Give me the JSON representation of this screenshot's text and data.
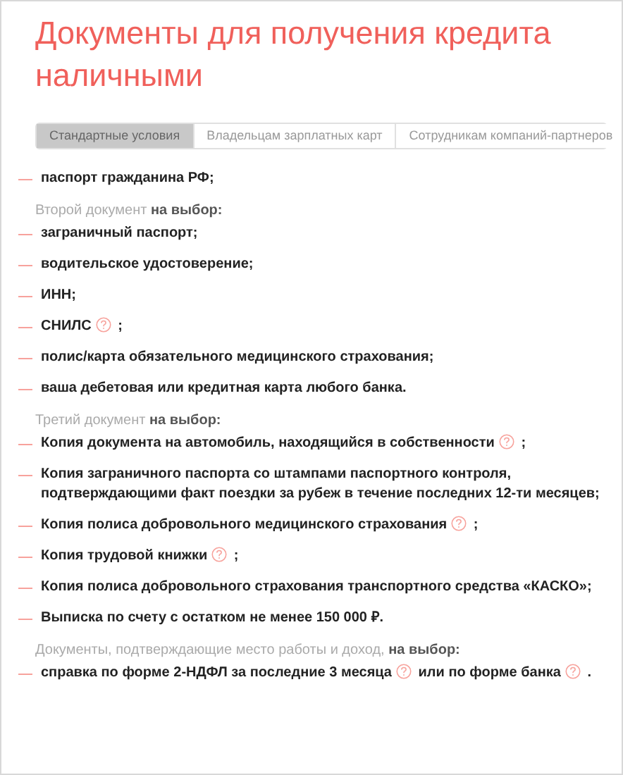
{
  "title": "Документы для получения кредита наличными",
  "tabs": [
    {
      "label": "Стандартные условия",
      "selected": true
    },
    {
      "label": "Владельцам зарплатных карт",
      "selected": false
    },
    {
      "label": "Сотрудникам компаний-партнеров",
      "selected": false
    }
  ],
  "sections": [
    {
      "items": [
        {
          "parts": [
            "паспорт гражданина РФ;"
          ]
        }
      ]
    },
    {
      "heading": "Второй документ **на выбор:**",
      "items": [
        {
          "parts": [
            "заграничный паспорт;"
          ]
        },
        {
          "parts": [
            "водительское удостоверение;"
          ]
        },
        {
          "parts": [
            "ИНН;"
          ]
        },
        {
          "parts": [
            "СНИЛС",
            ";"
          ]
        },
        {
          "parts": [
            "полис/карта обязательного медицинского страхования;"
          ]
        },
        {
          "parts": [
            "ваша дебетовая или кредитная карта любого банка."
          ]
        }
      ]
    },
    {
      "heading": "Третий документ **на выбор:**",
      "items": [
        {
          "parts": [
            "Копия документа на автомобиль, находящийся в собственности",
            ";"
          ]
        },
        {
          "parts": [
            "Копия заграничного паспорта со штампами паспортного контроля, подтверждающими факт поездки за рубеж в течение последних 12-ти месяцев;"
          ]
        },
        {
          "parts": [
            "Копия полиса добровольного медицинского страхования",
            ";"
          ]
        },
        {
          "parts": [
            "Копия трудовой книжки",
            ";"
          ]
        },
        {
          "parts": [
            "Копия полиса добровольного страхования транспортного средства «КАСКО»;"
          ]
        },
        {
          "parts": [
            "Выписка по счету с остатком не менее 150 000 ₽."
          ]
        }
      ]
    },
    {
      "heading": "Документы, подтверждающие место работы и доход, **на выбор:**",
      "items": [
        {
          "parts": [
            "справка по форме 2-НДФЛ за последние 3 месяца",
            "или по форме банка",
            "."
          ]
        }
      ]
    }
  ]
}
